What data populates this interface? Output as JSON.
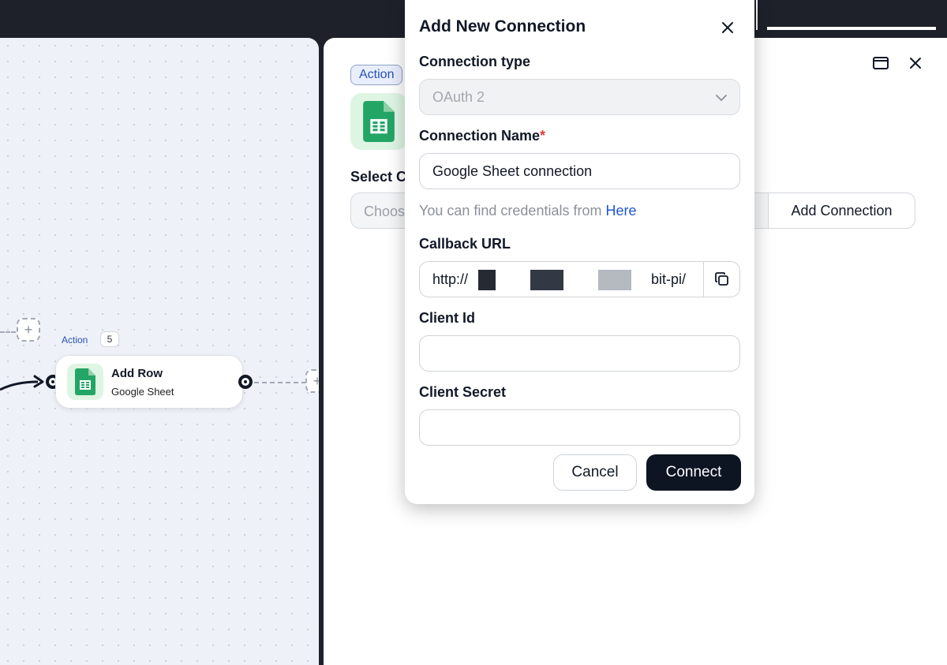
{
  "canvas": {
    "node": {
      "tag": "Action",
      "count": "5",
      "title": "Add Row",
      "subtitle": "Google Sheet",
      "icon": "google-sheets-icon"
    }
  },
  "panel": {
    "badge": "Action",
    "icon": "google-sheets-icon",
    "select_label": "Select C",
    "select_placeholder": "Choos",
    "add_connection": "Add Connection"
  },
  "modal": {
    "title": "Add New Connection",
    "connection_type": {
      "label": "Connection type",
      "value": "OAuth 2"
    },
    "connection_name": {
      "label": "Connection Name",
      "required_mark": "*",
      "value": "Google Sheet connection"
    },
    "hint": {
      "text": "You can find credentials from",
      "link": "Here"
    },
    "callback_url": {
      "label": "Callback URL",
      "value_start": "http://",
      "value_end": "bit-pi/"
    },
    "client_id": {
      "label": "Client Id",
      "value": ""
    },
    "client_secret": {
      "label": "Client Secret",
      "value": ""
    },
    "cancel": "Cancel",
    "connect": "Connect"
  },
  "colors": {
    "accent_link": "#1f56d1",
    "primary_button": "#0d1422",
    "required": "#e23b3b",
    "sheets_green": "#23a566"
  }
}
